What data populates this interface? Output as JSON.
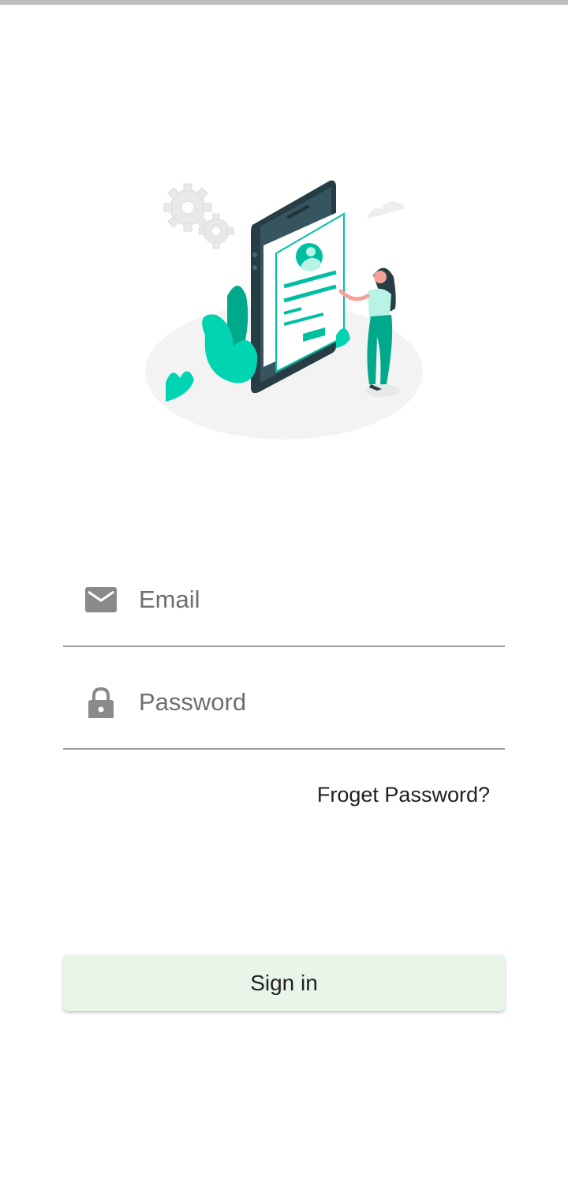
{
  "login_form": {
    "email": {
      "placeholder": "Email",
      "value": "",
      "icon": "email-icon"
    },
    "password": {
      "placeholder": "Password",
      "value": "",
      "icon": "lock-icon"
    },
    "forgot_label": "Froget Password?",
    "signin_label": "Sign in"
  },
  "theme": {
    "accent": "#00bfa0",
    "button_bg": "#e8f5e9",
    "icon_color": "#8a8a8a"
  }
}
